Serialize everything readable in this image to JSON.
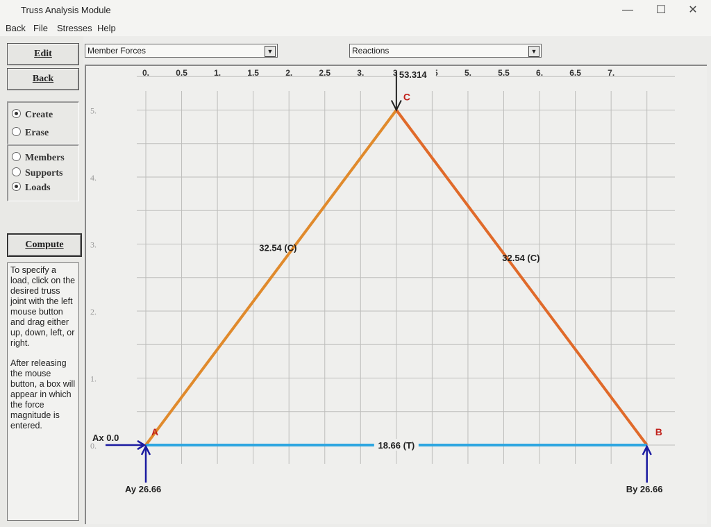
{
  "window": {
    "title": "Truss Analysis Module",
    "minimize": "—",
    "maximize": "☐",
    "close": "✕"
  },
  "menu": [
    "Back",
    "File",
    "Stresses",
    "Help"
  ],
  "buttons": {
    "edit": "Edit",
    "back": "Back",
    "compute": "Compute"
  },
  "mode_group": [
    {
      "label": "Create",
      "selected": true
    },
    {
      "label": "Erase",
      "selected": false
    }
  ],
  "type_group": [
    {
      "label": "Members",
      "selected": false
    },
    {
      "label": "Supports",
      "selected": false
    },
    {
      "label": "Loads",
      "selected": true
    }
  ],
  "help_text": [
    "To specify a load, click on the desired truss joint with the left mouse button and drag either up, down, left, or right.",
    "After releasing the mouse button, a box will appear in which the force magnitude is entered."
  ],
  "dropdowns": {
    "left": "Member Forces",
    "right": "Reactions"
  },
  "chart_data": {
    "type": "truss",
    "x_ticks": [
      "0.",
      "0.5",
      "1.",
      "1.5",
      "2.",
      "2.5",
      "3.",
      "3.",
      "4.5",
      "5.",
      "5.5",
      "6.",
      "6.5",
      "7."
    ],
    "y_ticks": [
      "5.",
      "4.",
      "3.",
      "2.",
      "1.",
      "0."
    ],
    "xlim": [
      0,
      7.2
    ],
    "ylim": [
      0,
      5
    ],
    "nodes": [
      {
        "name": "A",
        "x": 0,
        "y": 0
      },
      {
        "name": "B",
        "x": 7,
        "y": 0
      },
      {
        "name": "C",
        "x": 3.5,
        "y": 5
      }
    ],
    "members": [
      {
        "from": "A",
        "to": "C",
        "label": "32.54 (C)",
        "color": "#e08a2c"
      },
      {
        "from": "C",
        "to": "B",
        "label": "32.54 (C)",
        "color": "#e06a2a"
      },
      {
        "from": "A",
        "to": "B",
        "label": "18.66 (T)",
        "color": "#2ea6e0"
      }
    ],
    "load": {
      "node": "C",
      "label": "53.314",
      "direction": "down",
      "color": "#222222"
    },
    "reactions": [
      {
        "node": "A",
        "label": "Ax 0.0",
        "direction": "right"
      },
      {
        "node": "A",
        "label": "Ay 26.66",
        "direction": "up"
      },
      {
        "node": "B",
        "label": "By 26.66",
        "direction": "up"
      }
    ],
    "reaction_color": "#1a1aa0",
    "node_label_color": "#c0201a"
  }
}
